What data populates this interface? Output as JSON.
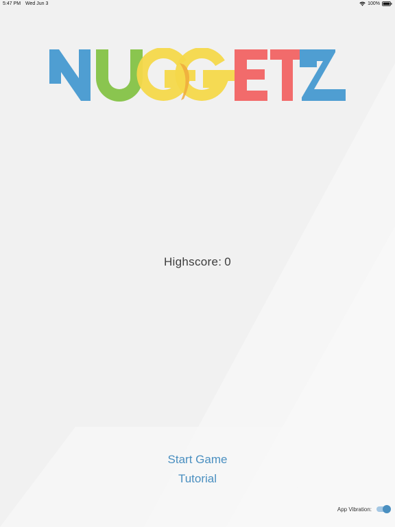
{
  "status_bar": {
    "time": "5:47 PM",
    "date": "Wed Jun 3",
    "battery": "100%",
    "wifi_icon": "wifi-icon",
    "battery_icon": "battery-icon"
  },
  "logo": {
    "text": "NUGGETZ",
    "letters": [
      {
        "char": "N",
        "color": "#4f9ed2"
      },
      {
        "char": "U",
        "color": "#8ac54f"
      },
      {
        "char": "G",
        "color": "#f4d84a"
      },
      {
        "char": "G",
        "color": "#f4d84a"
      },
      {
        "char": "E",
        "color": "#f26b6b"
      },
      {
        "char": "T",
        "color": "#f26b6b"
      },
      {
        "char": "Z",
        "color": "#4f9ed2"
      }
    ],
    "overlap_color": "#eeaa3c"
  },
  "highscore": {
    "label": "Highscore:",
    "value": "0"
  },
  "menu": {
    "start_label": "Start Game",
    "tutorial_label": "Tutorial"
  },
  "settings": {
    "vibration_label": "App Vibration:",
    "vibration_on": true
  },
  "colors": {
    "background": "#f1f1f1",
    "accent": "#4a8fc0"
  }
}
